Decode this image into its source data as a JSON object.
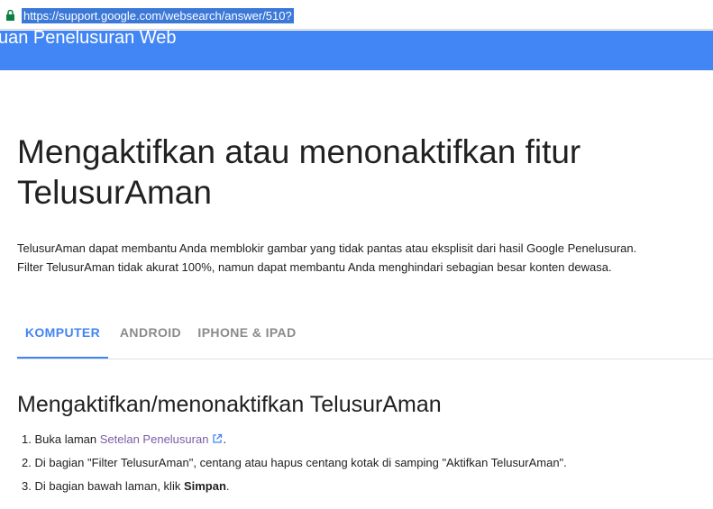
{
  "browser": {
    "url": "https://support.google.com/websearch/answer/510?"
  },
  "banner": {
    "title": "uan Penelusuran Web",
    "color": "#4285f4"
  },
  "article": {
    "title": "Mengaktifkan atau menonaktifkan fitur TelusurAman",
    "intro_line1": "TelusurAman dapat membantu Anda memblokir gambar yang tidak pantas atau eksplisit dari hasil Google Penelusuran.",
    "intro_line2": "Filter TelusurAman tidak akurat 100%, namun dapat membantu Anda menghindari sebagian besar konten dewasa."
  },
  "tabs": [
    {
      "label": "KOMPUTER",
      "active": true
    },
    {
      "label": "ANDROID",
      "active": false
    },
    {
      "label": "IPHONE & IPAD",
      "active": false
    }
  ],
  "section": {
    "title": "Mengaktifkan/menonaktifkan TelusurAman",
    "steps": [
      {
        "number": "1.",
        "prefix": "Buka laman ",
        "link": "Setelan Penelusuran",
        "suffix": "."
      },
      {
        "number": "2.",
        "text": "Di bagian \"Filter TelusurAman\", centang atau hapus centang kotak di samping \"Aktifkan TelusurAman\"."
      },
      {
        "number": "3.",
        "prefix": "Di bagian bawah laman, klik ",
        "bold": "Simpan",
        "suffix": "."
      }
    ]
  },
  "icons": {
    "lock": "lock-icon",
    "external": "external-link-icon"
  },
  "colors": {
    "accent": "#4285f4",
    "link": "#7b5ca8",
    "url_highlight": "#3b78d8",
    "lock": "#0b8043"
  }
}
